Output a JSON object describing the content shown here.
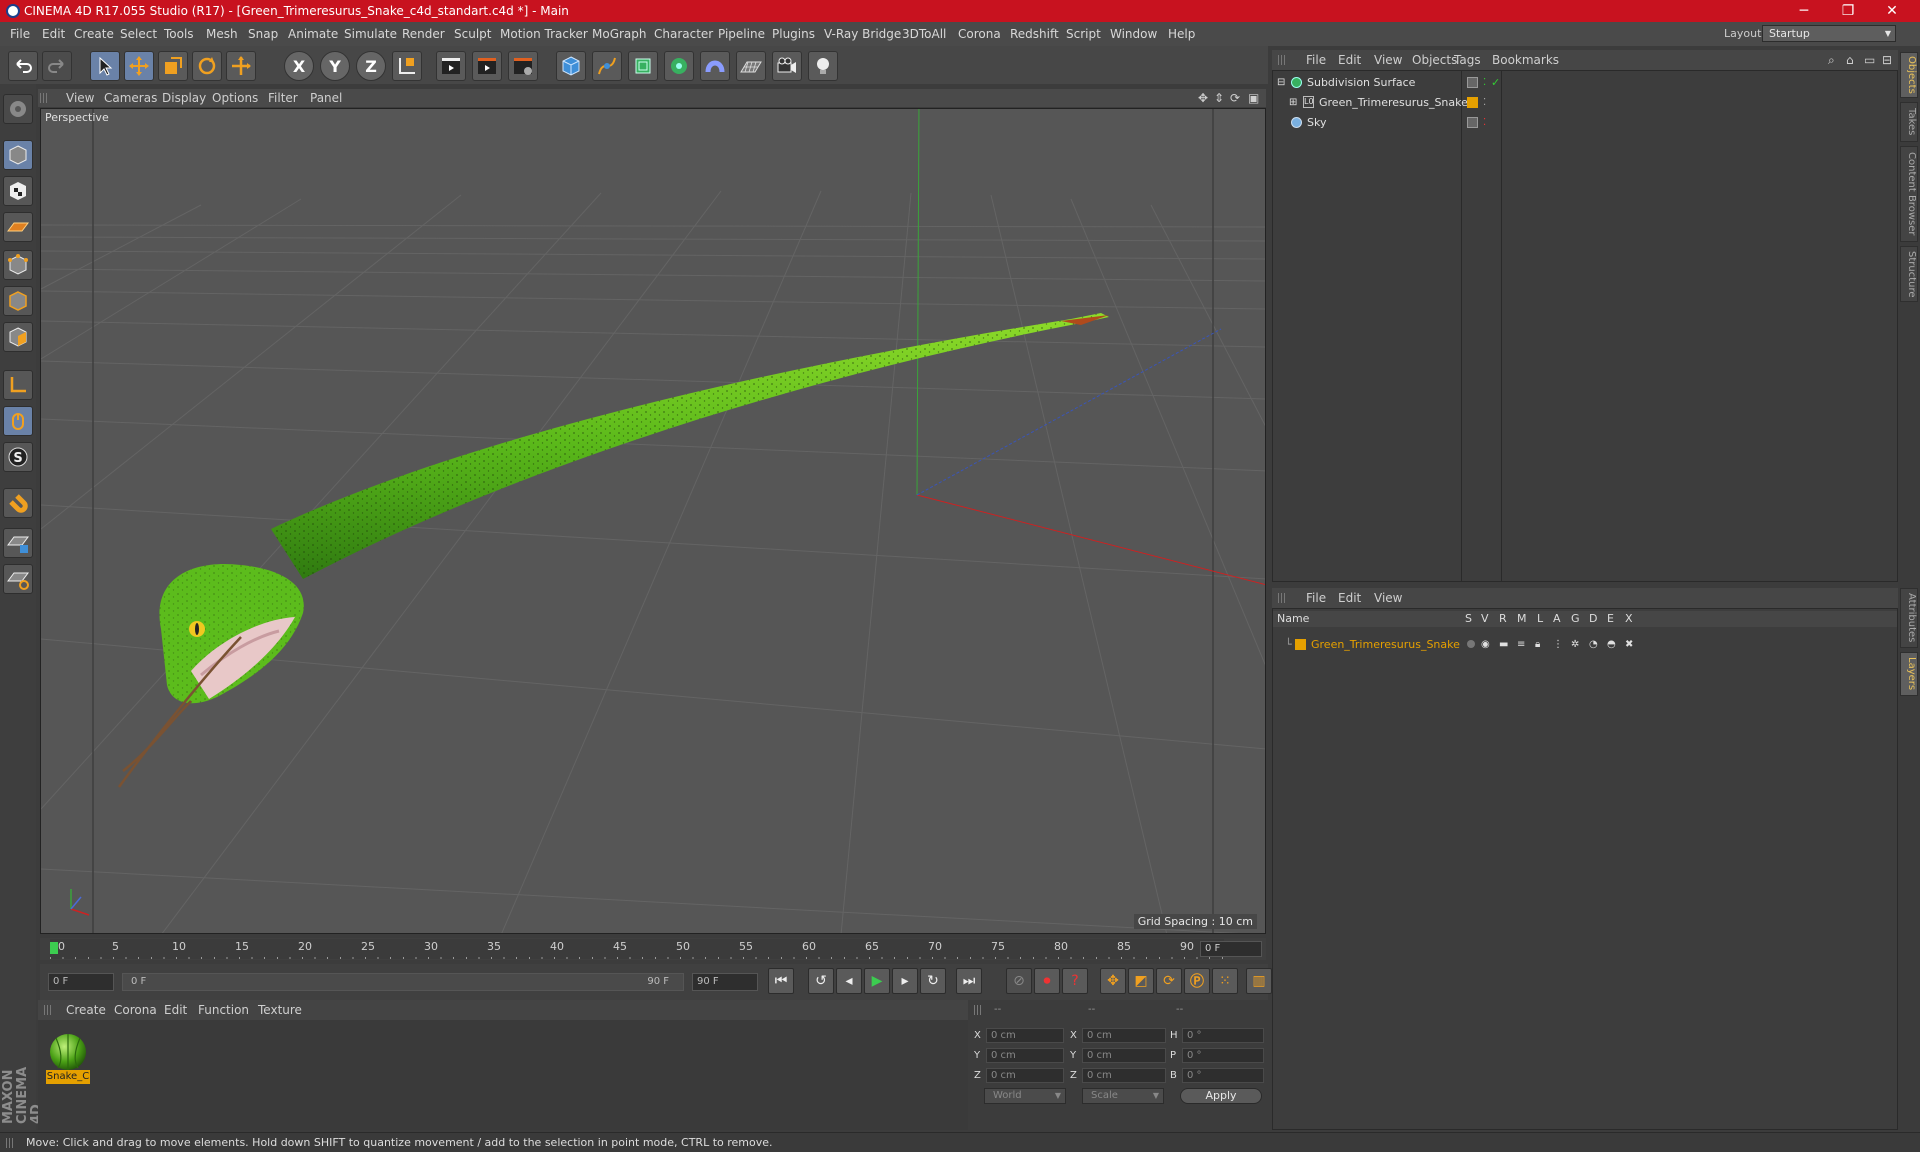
{
  "window": {
    "title": "CINEMA 4D R17.055 Studio (R17) - [Green_Trimeresurus_Snake_c4d_standart.c4d *] - Main",
    "minimize": "─",
    "maximize": "❐",
    "close": "✕"
  },
  "menubar": {
    "items": [
      "File",
      "Edit",
      "Create",
      "Select",
      "Tools",
      "Mesh",
      "Snap",
      "Animate",
      "Simulate",
      "Render",
      "Sculpt",
      "Motion Tracker",
      "MoGraph",
      "Character",
      "Pipeline",
      "Plugins",
      "V-Ray Bridge",
      "3DToAll",
      "Corona",
      "Redshift",
      "Script",
      "Window",
      "Help"
    ],
    "layout_label": "Layout:",
    "layout_value": "Startup"
  },
  "toolbar": {
    "axis_x": "X",
    "axis_y": "Y",
    "axis_z": "Z"
  },
  "viewport": {
    "menu": [
      "View",
      "Cameras",
      "Display",
      "Options",
      "Filter",
      "Panel"
    ],
    "label": "Perspective",
    "grid_spacing": "Grid Spacing : 10 cm"
  },
  "timeline": {
    "ticks": [
      "0",
      "5",
      "10",
      "15",
      "20",
      "25",
      "30",
      "35",
      "40",
      "45",
      "50",
      "55",
      "60",
      "65",
      "70",
      "75",
      "80",
      "85",
      "90"
    ],
    "current_frame": "0 F",
    "start_field": "0 F",
    "range_start": "0 F",
    "range_end": "90 F",
    "end_field": "90 F"
  },
  "materials": {
    "menu": [
      "Create",
      "Corona",
      "Edit",
      "Function",
      "Texture"
    ],
    "items": [
      {
        "name": "Snake_C"
      }
    ]
  },
  "coordinates": {
    "headers": [
      "--",
      "--",
      "--"
    ],
    "rows": [
      {
        "a": "X",
        "av": "0 cm",
        "b": "X",
        "bv": "0 cm",
        "c": "H",
        "cv": "0 °"
      },
      {
        "a": "Y",
        "av": "0 cm",
        "b": "Y",
        "bv": "0 cm",
        "c": "P",
        "cv": "0 °"
      },
      {
        "a": "Z",
        "av": "0 cm",
        "b": "Z",
        "bv": "0 cm",
        "c": "B",
        "cv": "0 °"
      }
    ],
    "mode": "World",
    "mode2": "Scale",
    "apply": "Apply"
  },
  "objects": {
    "menu": [
      "File",
      "Edit",
      "View",
      "Objects",
      "Tags",
      "Bookmarks"
    ],
    "rows": [
      {
        "name": "Subdivision Surface"
      },
      {
        "name": "Green_Trimeresurus_Snake"
      },
      {
        "name": "Sky"
      }
    ]
  },
  "layers": {
    "menu": [
      "File",
      "Edit",
      "View"
    ],
    "columns": [
      "Name",
      "S",
      "V",
      "R",
      "M",
      "L",
      "A",
      "G",
      "D",
      "E",
      "X"
    ],
    "rows": [
      {
        "name": "Green_Trimeresurus_Snake"
      }
    ]
  },
  "right_tabs": [
    "Objects",
    "Takes",
    "Content Browser",
    "Structure",
    "Attributes",
    "Layers"
  ],
  "status": "Move: Click and drag to move elements. Hold down SHIFT to quantize movement / add to the selection in point mode, CTRL to remove.",
  "brand": {
    "text": "MAXON CINEMA 4D"
  },
  "colors": {
    "title_bar": "#c8121f",
    "accent": "#e5a000",
    "snake": "#5ab81a"
  }
}
